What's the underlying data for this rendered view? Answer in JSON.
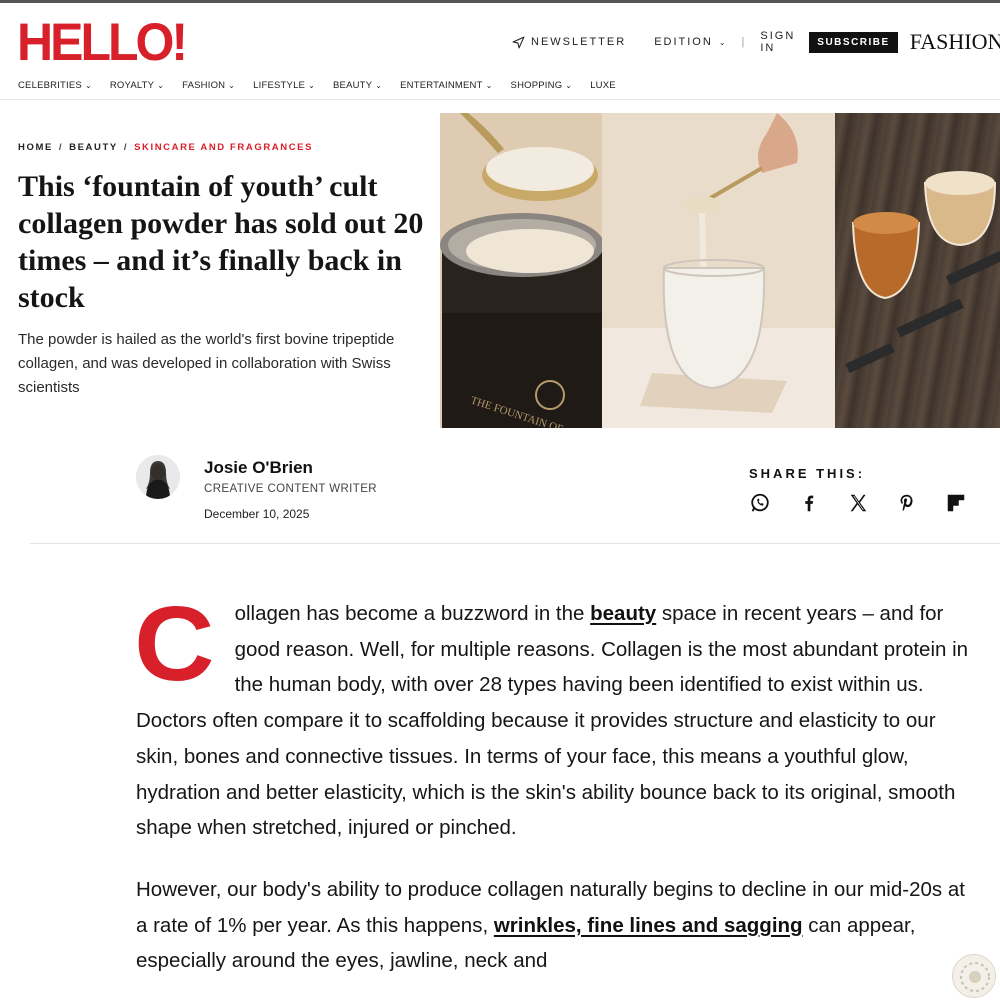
{
  "header": {
    "logo": "HELLO!",
    "newsletter": "NEWSLETTER",
    "edition": "EDITION",
    "divider": "|",
    "sign_in": "SIGN IN",
    "subscribe": "SUBSCRIBE",
    "fashion_logo": "FASHION"
  },
  "nav": [
    {
      "label": "CELEBRITIES"
    },
    {
      "label": "ROYALTY"
    },
    {
      "label": "FASHION"
    },
    {
      "label": "LIFESTYLE"
    },
    {
      "label": "BEAUTY"
    },
    {
      "label": "ENTERTAINMENT"
    },
    {
      "label": "SHOPPING"
    },
    {
      "label": "LUXE"
    }
  ],
  "breadcrumb": {
    "home": "HOME",
    "beauty": "BEAUTY",
    "current": "SKINCARE AND FRAGRANCES",
    "separator": "/"
  },
  "article": {
    "headline": "This ‘fountain of youth’ cult collagen powder has sold out 20 times – and it’s finally back in stock",
    "standfirst": "The powder is hailed as the world's first bovine tripeptide collagen, and was developed in collaboration with Swiss scientists",
    "hero_jar_text": "THE FOUNTAIN OF"
  },
  "author": {
    "name": "Josie O'Brien",
    "role": "CREATIVE CONTENT WRITER",
    "date": "December 10, 2025"
  },
  "share": {
    "label": "SHARE THIS:",
    "icons": [
      "whatsapp-icon",
      "facebook-icon",
      "x-icon",
      "pinterest-icon",
      "flipboard-icon"
    ]
  },
  "body": {
    "dropcap": "C",
    "p1_a": "ollagen has become a buzzword in the ",
    "p1_link": "beauty",
    "p1_b": " space in recent years – and for good reason. Well, for multiple reasons. Collagen is the most abundant protein in the human body, with over 28 types having been identified to exist within us. Doctors often compare it to scaffolding because it provides structure and elasticity to our skin, bones and connective tissues. In terms of your face, this means a youthful glow, hydration and better elasticity, which is the skin's ability bounce back to its original, smooth shape when stretched, injured or pinched.",
    "p2_a": "However, our body's ability to produce collagen naturally begins to decline in our mid-20s at a rate of 1% per year. As this happens, ",
    "p2_link": "wrinkles, fine lines and sagging",
    "p2_b": " can appear, especially around the eyes, jawline, neck and"
  },
  "colors": {
    "brand_red": "#d8202a",
    "text": "#161616"
  }
}
